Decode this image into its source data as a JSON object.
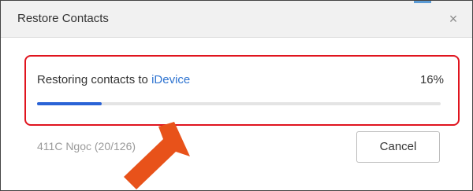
{
  "dialog": {
    "title": "Restore Contacts",
    "close_label": "×"
  },
  "progress": {
    "status_prefix": "Restoring contacts to ",
    "device_name": "iDevice",
    "percent_label": "16%",
    "fraction": 0.16,
    "current_item": "411C Ngọc (20/126)"
  },
  "buttons": {
    "cancel_label": "Cancel"
  },
  "colors": {
    "accent_blue": "#2a63d6",
    "device_link": "#2f74d0",
    "highlight_red": "#e0141e",
    "arrow_orange": "#e8521a"
  },
  "icons": {
    "close": "close-icon",
    "annotation": "pointer-arrow-icon"
  }
}
